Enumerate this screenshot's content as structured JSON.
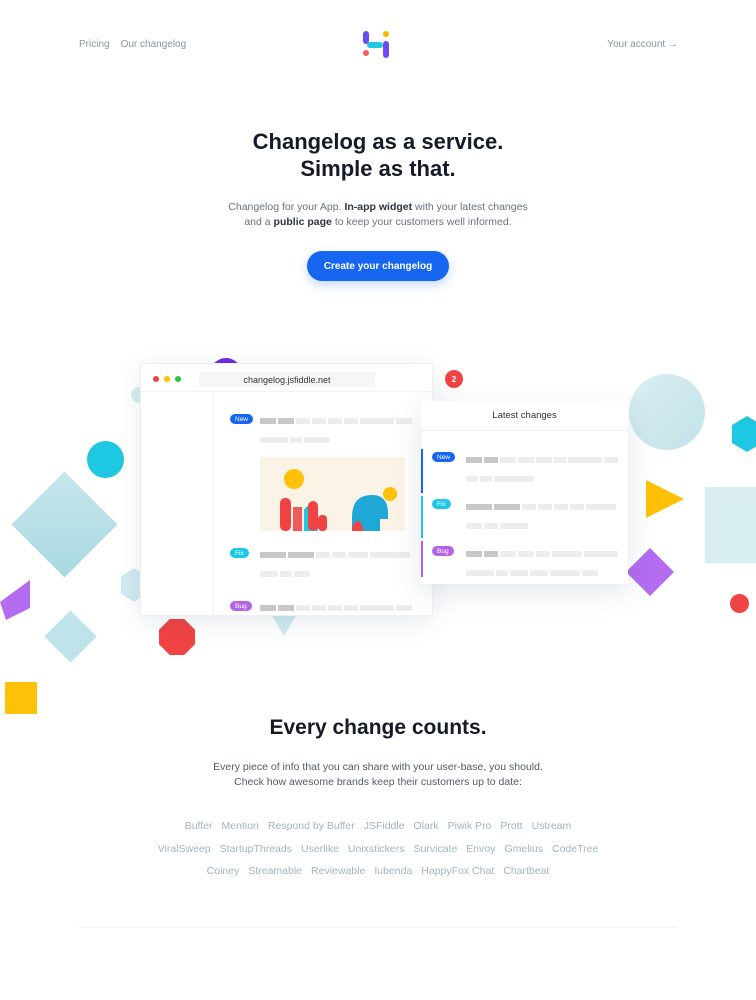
{
  "nav": {
    "links": [
      "Pricing",
      "Our changelog"
    ],
    "account": "Your account →"
  },
  "logo": {
    "colors": [
      "#ff5a5f",
      "#ffb400",
      "#1fc8e2",
      "#6c4bf4"
    ]
  },
  "hero": {
    "title_line1": "Changelog as a service.",
    "title_line2": "Simple as that.",
    "desc_1": "Changelog for your App.",
    "desc_b1": "In-app widget",
    "desc_2": "with your latest changes",
    "desc_3": "and a",
    "desc_b2": "public page",
    "desc_4": "to keep your customers well informed.",
    "cta": "Create your changelog"
  },
  "browser": {
    "url": "changelog.jsfiddle.net",
    "tags": [
      "New",
      "Fix",
      "Bug"
    ]
  },
  "widget": {
    "title": "Latest changes",
    "badge": "2",
    "tags": [
      "New",
      "Fix",
      "Bug"
    ]
  },
  "section2": {
    "title": "Every change counts.",
    "line1": "Every piece of info that you can share with your user-base, you should.",
    "line2": "Check how awesome brands keep their customers up to date:"
  },
  "brands": [
    [
      "Buffer",
      "Mention",
      "Respond by Buffer",
      "JSFiddle",
      "Olark",
      "Piwik Pro",
      "Prott",
      "Ustream"
    ],
    [
      "ViralSweep",
      "StartupThreads",
      "Userlike",
      "Unixstickers",
      "Survicate",
      "Envoy",
      "Gmelius",
      "CodeTree"
    ],
    [
      "Coiney",
      "Streamable",
      "Reviewable",
      "Iubenda",
      "HappyFox Chat",
      "Chartbeat"
    ]
  ],
  "colors": {
    "accent": "#1766f2",
    "fix": "#1fc8e2",
    "bug": "#b363e8",
    "badge": "#f04343"
  }
}
